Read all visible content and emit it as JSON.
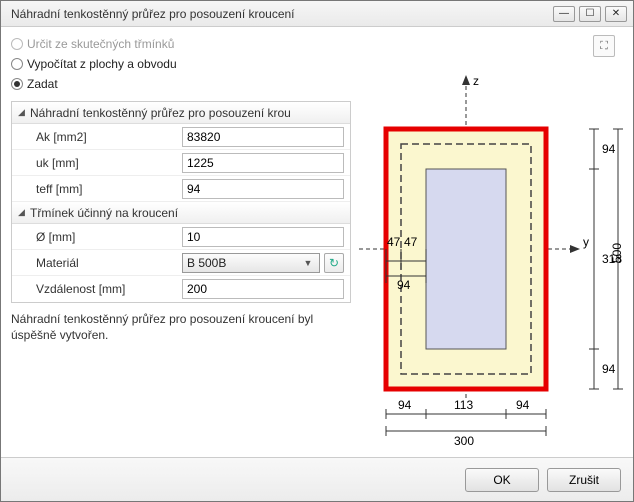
{
  "window": {
    "title": "Náhradní tenkostěnný průřez pro posouzení kroucení"
  },
  "radios": {
    "r1": "Určit ze skutečných třmínků",
    "r2": "Vypočítat z plochy a obvodu",
    "r3": "Zadat"
  },
  "group1": {
    "header": "Náhradní tenkostěnný průřez pro posouzení krou",
    "ak_label": "Ak [mm2]",
    "ak_val": "83820",
    "uk_label": "uk [mm]",
    "uk_val": "1225",
    "teff_label": "teff [mm]",
    "teff_val": "94"
  },
  "group2": {
    "header": "Třmínek účinný na kroucení",
    "dia_label": "Ø [mm]",
    "dia_val": "10",
    "mat_label": "Materiál",
    "mat_val": "B 500B",
    "dist_label": "Vzdálenost [mm]",
    "dist_val": "200"
  },
  "status": "Náhradní tenkostěnný průřez pro posouzení kroucení byl úspěšně vytvořen.",
  "footer": {
    "ok": "OK",
    "cancel": "Zrušit"
  },
  "diagram": {
    "z": "z",
    "y": "y",
    "d47a": "47",
    "d47b": "47",
    "d94s": "94",
    "d94t": "94",
    "d313": "313",
    "d94b": "94",
    "d500": "500",
    "b94l": "94",
    "b113": "113",
    "b94r": "94",
    "b300": "300"
  }
}
